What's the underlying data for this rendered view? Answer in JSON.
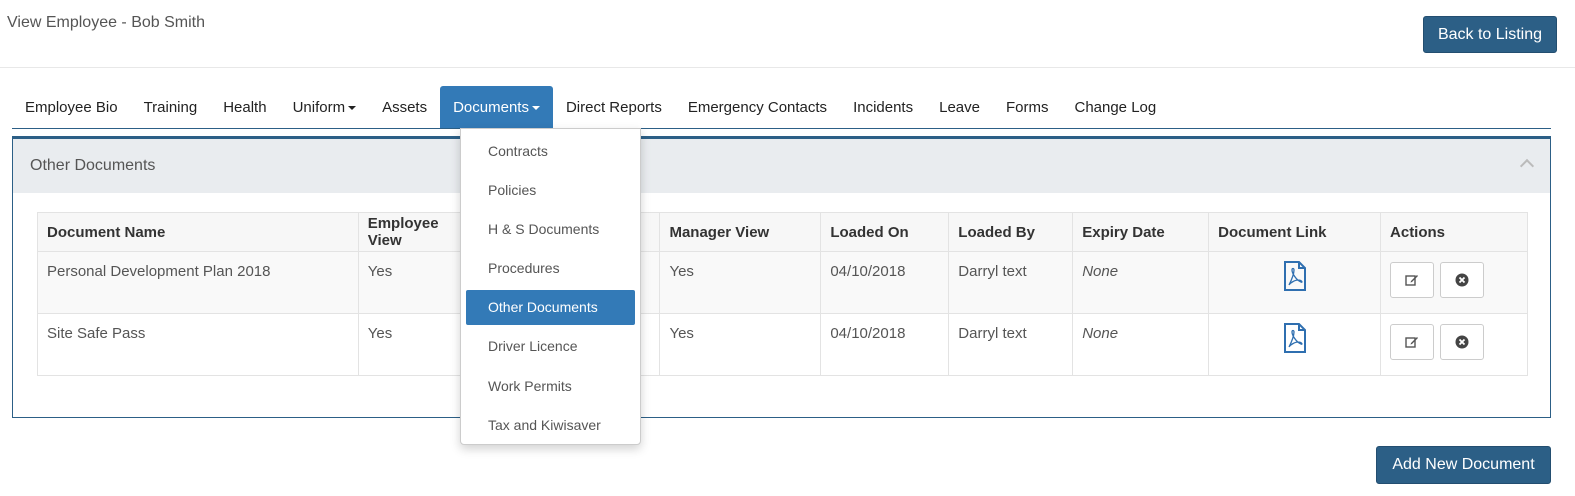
{
  "header": {
    "title": "View Employee - Bob Smith",
    "back_label": "Back to Listing"
  },
  "tabs": [
    {
      "label": "Employee Bio"
    },
    {
      "label": "Training"
    },
    {
      "label": "Health"
    },
    {
      "label": "Uniform"
    },
    {
      "label": "Assets"
    },
    {
      "label": "Documents"
    },
    {
      "label": "Direct Reports"
    },
    {
      "label": "Emergency Contacts"
    },
    {
      "label": "Incidents"
    },
    {
      "label": "Leave"
    },
    {
      "label": "Forms"
    },
    {
      "label": "Change Log"
    }
  ],
  "panel": {
    "title": "Other Documents"
  },
  "table": {
    "headers": [
      "Document Name",
      "Employee View",
      "",
      "Manager View",
      "Loaded On",
      "Loaded By",
      "Expiry Date",
      "Document Link",
      "Actions"
    ],
    "rows": [
      {
        "name": "Personal Development Plan 2018",
        "employee_view": "Yes",
        "manager_view": "Yes",
        "loaded_on": "04/10/2018",
        "loaded_by": "Darryl text",
        "expiry": "None"
      },
      {
        "name": "Site Safe Pass",
        "employee_view": "Yes",
        "manager_view": "Yes",
        "loaded_on": "04/10/2018",
        "loaded_by": "Darryl text",
        "expiry": "None"
      }
    ]
  },
  "dropdown": {
    "items": [
      {
        "label": "Contracts"
      },
      {
        "label": "Policies"
      },
      {
        "label": "H & S Documents"
      },
      {
        "label": "Procedures"
      },
      {
        "label": "Other Documents"
      },
      {
        "label": "Driver Licence"
      },
      {
        "label": "Work Permits"
      },
      {
        "label": "Tax and Kiwisaver"
      }
    ]
  },
  "footer": {
    "add_label": "Add New Document"
  },
  "icons": {
    "link": "pdf-file-icon",
    "edit": "edit-icon",
    "delete": "remove-circle-icon"
  },
  "colors": {
    "primary": "#337ab7",
    "button": "#2c5f86"
  }
}
